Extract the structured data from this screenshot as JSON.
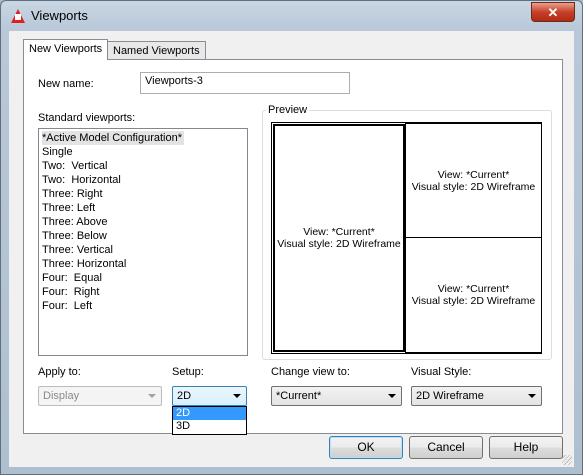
{
  "window": {
    "title": "Viewports",
    "close_symbol": "✕"
  },
  "tabs": [
    {
      "label": "New Viewports",
      "active": true
    },
    {
      "label": "Named Viewports",
      "active": false
    }
  ],
  "new_name": {
    "label": "New name:",
    "value": "Viewports-3"
  },
  "standard_viewports": {
    "label": "Standard viewports:",
    "items": [
      "*Active Model Configuration*",
      "Single",
      "Two:  Vertical",
      "Two:  Horizontal",
      "Three: Right",
      "Three: Left",
      "Three: Above",
      "Three: Below",
      "Three: Vertical",
      "Three: Horizontal",
      "Four:  Equal",
      "Four:  Right",
      "Four:  Left"
    ],
    "selected_index": 0
  },
  "preview": {
    "title": "Preview",
    "viewports": [
      {
        "view": "View: *Current*",
        "style": "Visual style: 2D Wireframe"
      },
      {
        "view": "View: *Current*",
        "style": "Visual style: 2D Wireframe"
      },
      {
        "view": "View: *Current*",
        "style": "Visual style: 2D Wireframe"
      }
    ]
  },
  "apply_to": {
    "label": "Apply to:",
    "value": "Display"
  },
  "setup": {
    "label": "Setup:",
    "value": "2D",
    "options": [
      "2D",
      "3D"
    ],
    "highlighted": "2D"
  },
  "change_view_to": {
    "label": "Change view to:",
    "value": "*Current*"
  },
  "visual_style": {
    "label": "Visual Style:",
    "value": "2D Wireframe"
  },
  "buttons": {
    "ok": "OK",
    "cancel": "Cancel",
    "help": "Help"
  }
}
